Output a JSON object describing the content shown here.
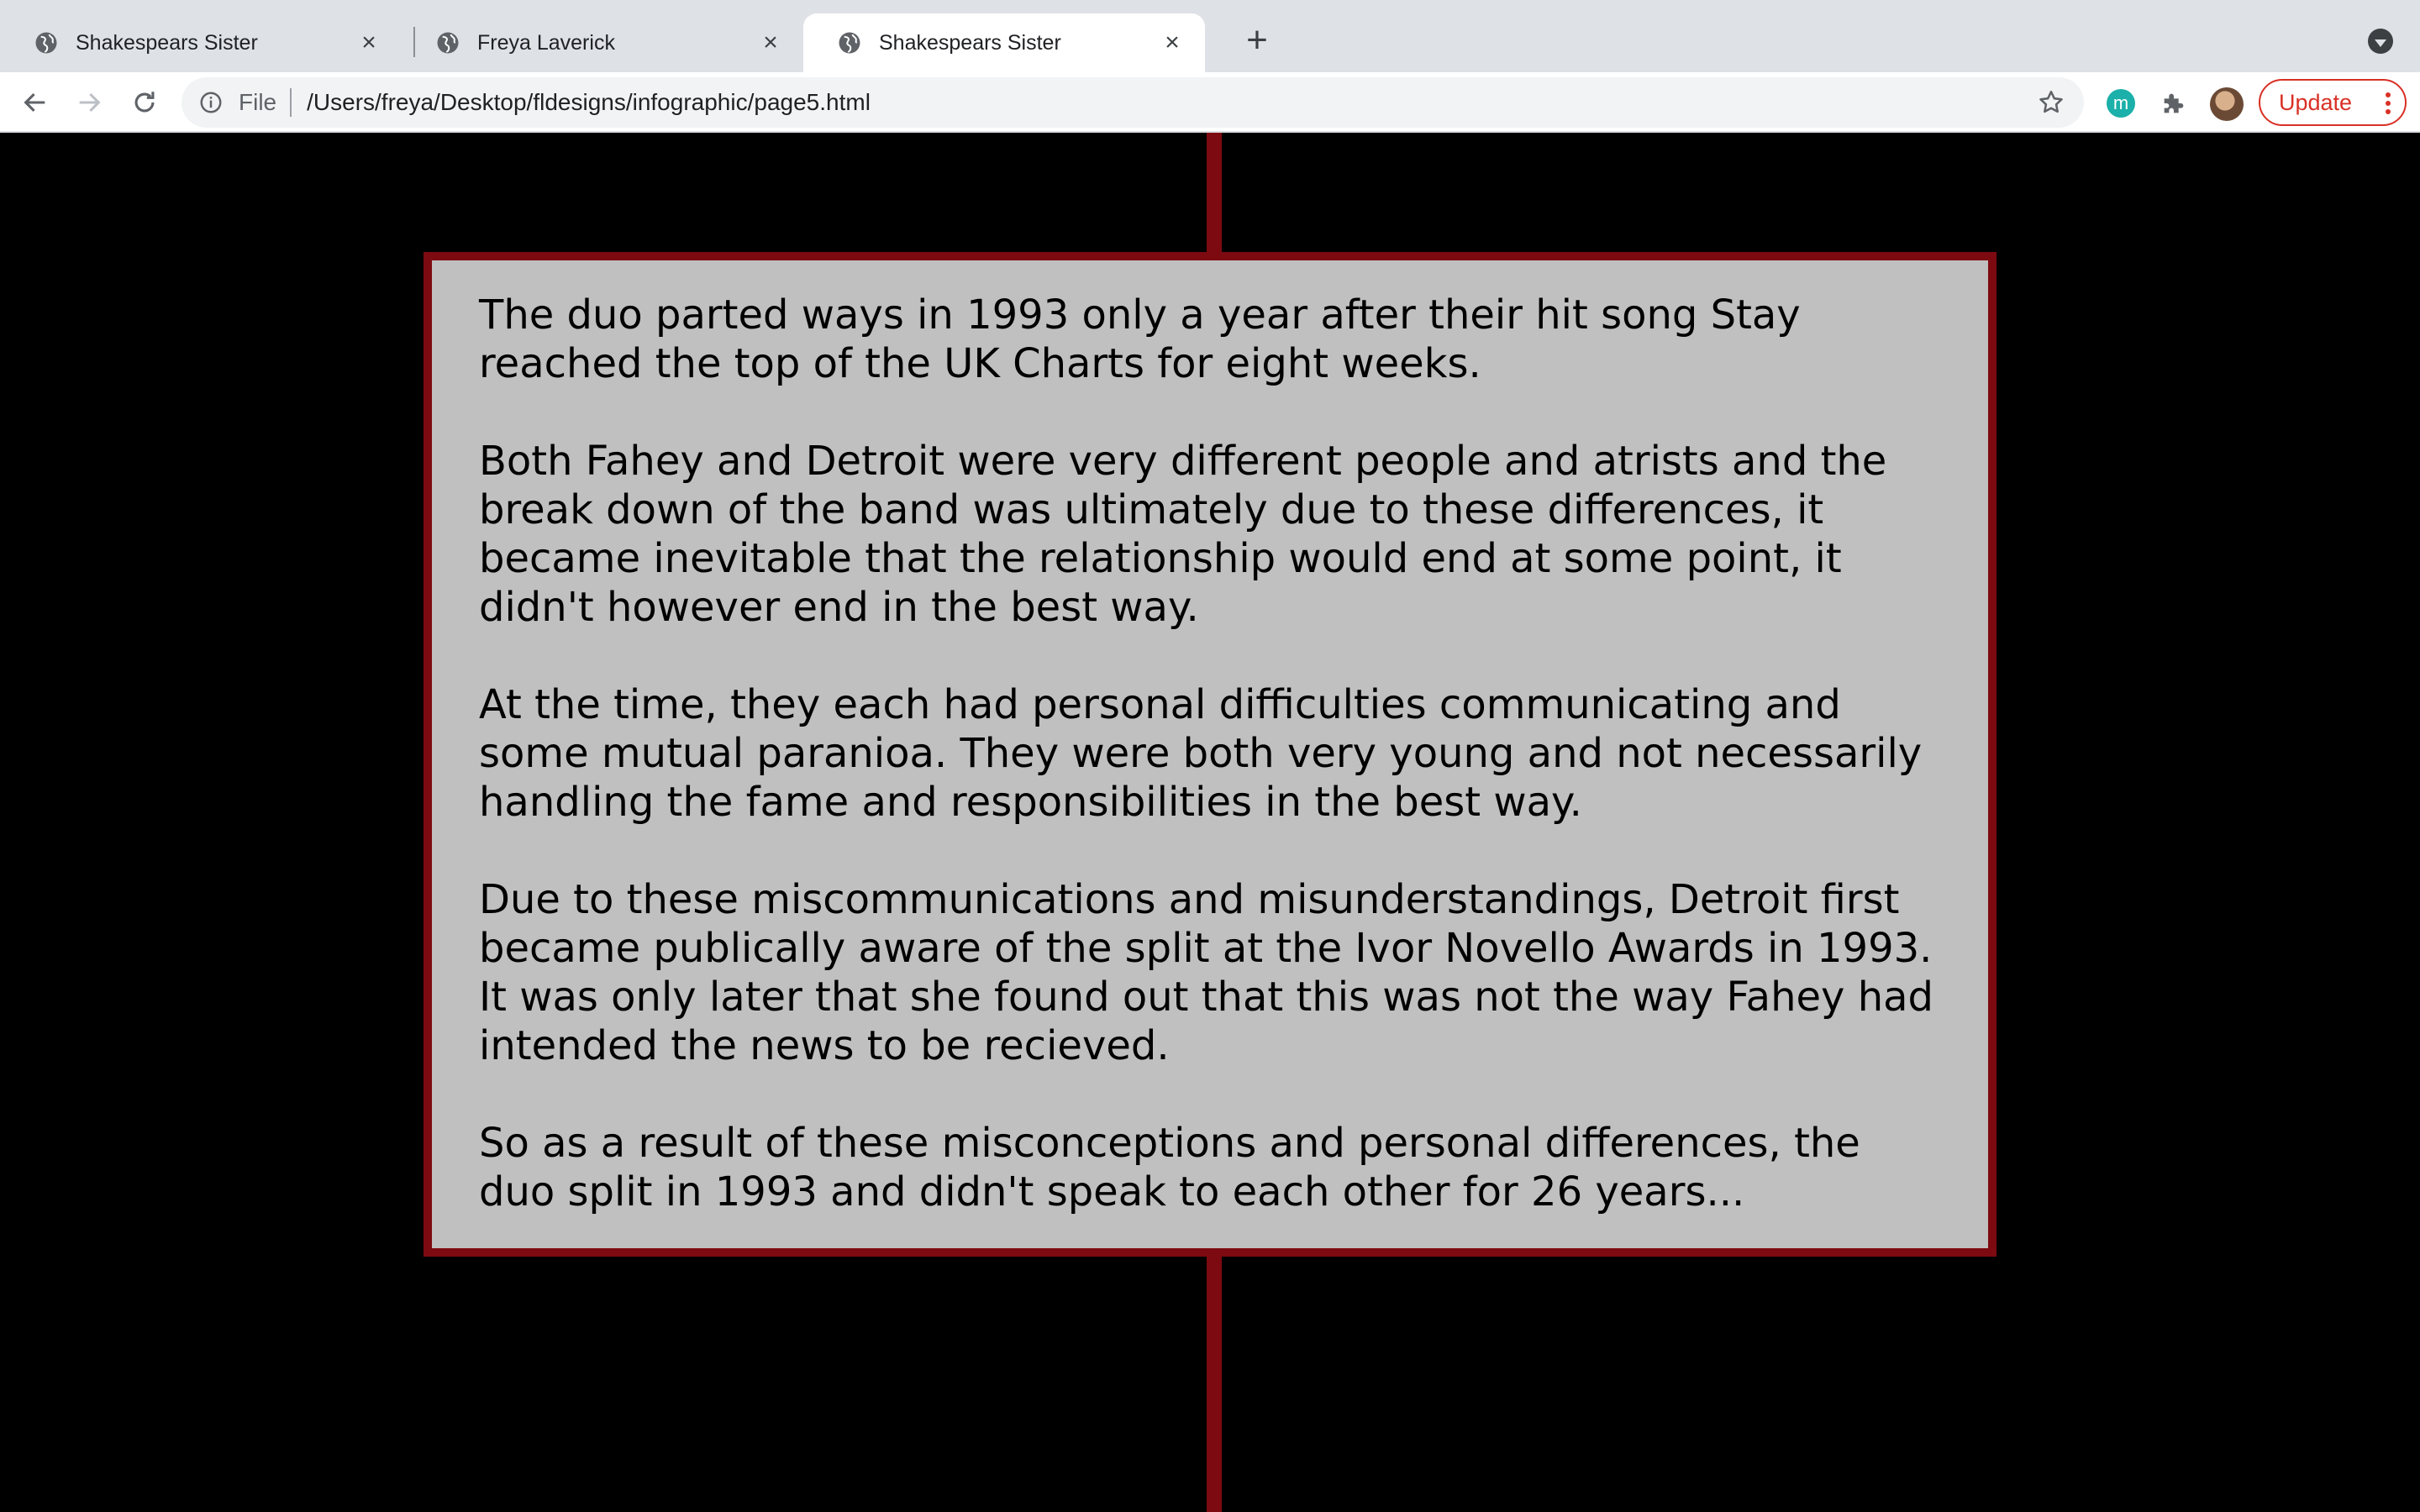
{
  "browser": {
    "tabs": [
      {
        "title": "Shakespears Sister",
        "active": false
      },
      {
        "title": "Freya Laverick",
        "active": false
      },
      {
        "title": "Shakespears Sister",
        "active": true
      }
    ],
    "omnibox": {
      "scheme_label": "File",
      "url": "/Users/freya/Desktop/fldesigns/infographic/page5.html"
    },
    "extensions": [
      {
        "name": "m-extension-icon",
        "letter": "m"
      },
      {
        "name": "puzzle-icon"
      }
    ],
    "update_label": "Update",
    "colors": {
      "update_accent": "#d93025",
      "tab_strip": "#dee1e6"
    }
  },
  "page": {
    "colors": {
      "background": "#000000",
      "timeline": "#7d0a10",
      "card_background": "#c0c0c0",
      "card_border": "#7d0a10"
    },
    "paragraphs": [
      "The duo parted ways in 1993 only a year after their hit song Stay reached the top of the UK Charts for eight weeks.",
      "Both Fahey and Detroit were very different people and atrists and the break down of the band was ultimately due to these differences, it became inevitable that the relationship would end at some point, it didn't however end in the best way.",
      "At the time, they each had personal difficulties communicating and some mutual paranioa. They were both very young and not necessarily handling the fame and responsibilities in the best way.",
      "Due to these miscommunications and misunderstandings, Detroit first became publically aware of the split at the Ivor Novello Awards in 1993. It was only later that she found out that this was not the way Fahey had intended the news to be recieved.",
      "So as a result of these misconceptions and personal differences, the duo split in 1993 and didn't speak to each other for 26 years..."
    ]
  }
}
